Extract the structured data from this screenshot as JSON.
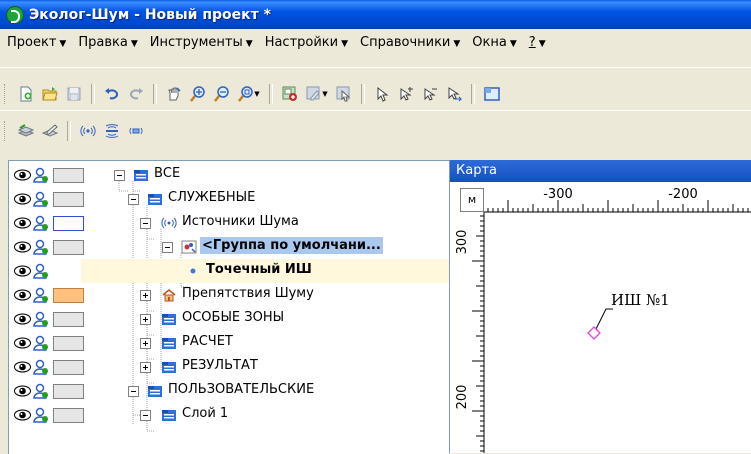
{
  "window": {
    "title": "Эколог-Шум - Новый проект *"
  },
  "menu": {
    "items": [
      {
        "label": "Проект",
        "arrow": "▼"
      },
      {
        "label": "Правка",
        "arrow": "▼"
      },
      {
        "label": "Инструменты",
        "arrow": "▼"
      },
      {
        "label": "Настройки",
        "arrow": "▼"
      },
      {
        "label": "Справочники",
        "arrow": "▼"
      },
      {
        "label": "Окна",
        "arrow": "▼"
      },
      {
        "label": "?",
        "arrow": "▼"
      }
    ]
  },
  "tree": {
    "nodes": [
      {
        "label": "ВСЕ"
      },
      {
        "label": "СЛУЖЕБНЫЕ"
      },
      {
        "label": "Источники Шума"
      },
      {
        "label": "<Группа по умолчани..."
      },
      {
        "label": "Точечный ИШ"
      },
      {
        "label": "Препятствия Шуму"
      },
      {
        "label": "ОСОБЫЕ ЗОНЫ"
      },
      {
        "label": "РАСЧЕТ"
      },
      {
        "label": "РЕЗУЛЬТАТ"
      },
      {
        "label": "ПОЛЬЗОВАТЕЛЬСКИЕ"
      },
      {
        "label": "Слой 1"
      }
    ],
    "colors": {
      "selection": "#aac8ee",
      "swatch_orange": "#ffc080",
      "swatch_blue_border": "#3050d0"
    }
  },
  "map": {
    "title": "Карта",
    "units": "м",
    "ruler_top_labels": [
      "-300",
      "-200"
    ],
    "ruler_left_labels": [
      "300",
      "200"
    ],
    "marker_label": "ИШ №1",
    "marker_color": "#e040e0"
  }
}
